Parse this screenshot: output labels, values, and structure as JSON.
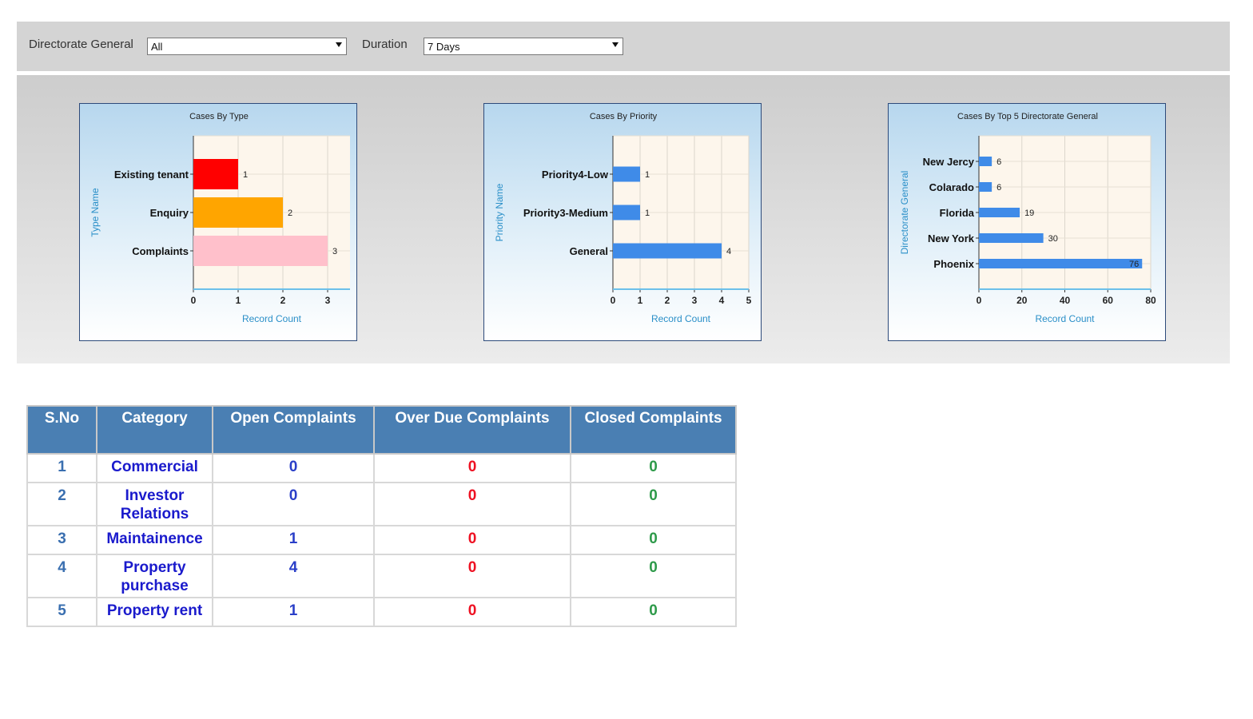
{
  "filters": {
    "directorate_label": "Directorate General",
    "directorate_value": "All",
    "duration_label": "Duration",
    "duration_value": "7 Days"
  },
  "charts": [
    {
      "title": "Cases By Type",
      "ylabel": "Type Name",
      "xlabel": "Record Count",
      "categories": [
        "Existing tenant",
        "Enquiry",
        "Complaints"
      ],
      "values": [
        1,
        2,
        3
      ],
      "colors": [
        "#ff0000",
        "#ffa500",
        "#ffc0cb"
      ],
      "xticks": [
        "0",
        "1",
        "2",
        "3"
      ],
      "xmax": 3.5
    },
    {
      "title": "Cases By Priority",
      "ylabel": "Priority Name",
      "xlabel": "Record Count",
      "categories": [
        "Priority4-Low",
        "Priority3-Medium",
        "General"
      ],
      "values": [
        1,
        1,
        4
      ],
      "colors": [
        "#3f8be8",
        "#3f8be8",
        "#3f8be8"
      ],
      "xticks": [
        "0",
        "1",
        "2",
        "3",
        "4",
        "5"
      ],
      "xmax": 5
    },
    {
      "title": "Cases By Top 5 Directorate General",
      "ylabel": "Directorate General",
      "xlabel": "Record Count",
      "categories": [
        "New Jercy",
        "Colarado",
        "Florida",
        "New York",
        "Phoenix"
      ],
      "values": [
        6,
        6,
        19,
        30,
        76
      ],
      "colors": [
        "#3f8be8",
        "#3f8be8",
        "#3f8be8",
        "#3f8be8",
        "#3f8be8"
      ],
      "xticks": [
        "0",
        "20",
        "40",
        "60",
        "80"
      ],
      "xmax": 80
    }
  ],
  "table": {
    "headers": [
      "S.No",
      "Category",
      "Open Complaints",
      "Over Due Complaints",
      "Closed Complaints"
    ],
    "rows": [
      {
        "sno": "1",
        "category": "Commercial",
        "open": "0",
        "overdue": "0",
        "closed": "0"
      },
      {
        "sno": "2",
        "category": "Investor Relations",
        "open": "0",
        "overdue": "0",
        "closed": "0"
      },
      {
        "sno": "3",
        "category": "Maintainence",
        "open": "1",
        "overdue": "0",
        "closed": "0"
      },
      {
        "sno": "4",
        "category": "Property purchase",
        "open": "4",
        "overdue": "0",
        "closed": "0"
      },
      {
        "sno": "5",
        "category": "Property rent",
        "open": "1",
        "overdue": "0",
        "closed": "0"
      }
    ]
  },
  "chart_data": [
    {
      "type": "bar",
      "title": "Cases By Type",
      "xlabel": "Record Count",
      "ylabel": "Type Name",
      "categories": [
        "Existing tenant",
        "Enquiry",
        "Complaints"
      ],
      "values": [
        1,
        2,
        3
      ],
      "xlim": [
        0,
        3.5
      ]
    },
    {
      "type": "bar",
      "title": "Cases By Priority",
      "xlabel": "Record Count",
      "ylabel": "Priority Name",
      "categories": [
        "Priority4-Low",
        "Priority3-Medium",
        "General"
      ],
      "values": [
        1,
        1,
        4
      ],
      "xlim": [
        0,
        5
      ]
    },
    {
      "type": "bar",
      "title": "Cases By Top 5 Directorate General",
      "xlabel": "Record Count",
      "ylabel": "Directorate General",
      "categories": [
        "New Jercy",
        "Colarado",
        "Florida",
        "New York",
        "Phoenix"
      ],
      "values": [
        6,
        6,
        19,
        30,
        76
      ],
      "xlim": [
        0,
        80
      ]
    }
  ]
}
